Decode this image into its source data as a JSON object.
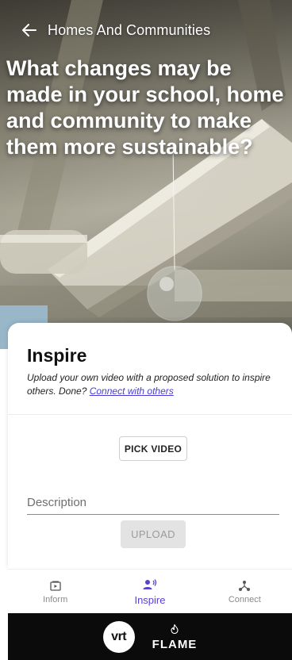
{
  "header": {
    "title": "Homes And Communities",
    "back_icon": "arrow-left-icon"
  },
  "hero": {
    "question": "What changes may be made in your school, home and community to make them more sustainable?"
  },
  "card": {
    "title": "Inspire",
    "description": "Upload your own video with a proposed solution to inspire others. Done? ",
    "link_label": "Connect with others",
    "pick_video_label": "PICK VIDEO",
    "description_placeholder": "Description",
    "description_value": "",
    "upload_label": "UPLOAD"
  },
  "bottom_nav": {
    "items": [
      {
        "label": "Inform",
        "icon": "play-screen-icon",
        "active": false
      },
      {
        "label": "Inspire",
        "icon": "speaking-person-icon",
        "active": true
      },
      {
        "label": "Connect",
        "icon": "network-icon",
        "active": false
      }
    ]
  },
  "footer": {
    "vrt_logo": "vrt",
    "flame_logo": "FLAME"
  },
  "colors": {
    "accent": "#5b3fd0",
    "link": "#4b3bd6",
    "footer_bg": "#0b0b0b"
  }
}
